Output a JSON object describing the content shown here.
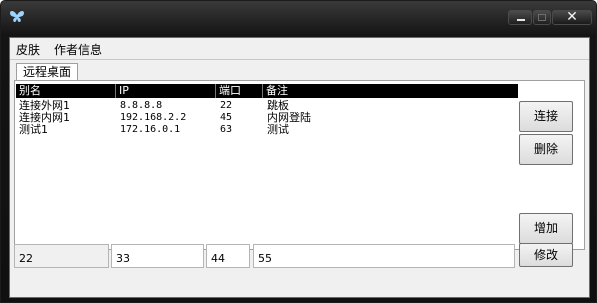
{
  "window": {
    "title_icon": "butterfly-icon",
    "close_glyph": "✕"
  },
  "menu": [
    {
      "label": "皮肤"
    },
    {
      "label": "作者信息"
    }
  ],
  "tab": {
    "label": "远程桌面"
  },
  "list": {
    "columns": [
      "别名",
      "IP",
      "端口",
      "备注"
    ],
    "rows": [
      [
        "连接外网1",
        "8.8.8.8",
        "22",
        "跳板"
      ],
      [
        "连接内网1",
        "192.168.2.2",
        "45",
        "内网登陆"
      ],
      [
        "测试1",
        "172.16.0.1",
        "63",
        "测试"
      ]
    ]
  },
  "buttons": {
    "connect": "连接",
    "delete": "删除",
    "add": "增加",
    "edit": "修改"
  },
  "fields": {
    "alias": "22",
    "ip": "33",
    "port": "44",
    "note": "55"
  }
}
